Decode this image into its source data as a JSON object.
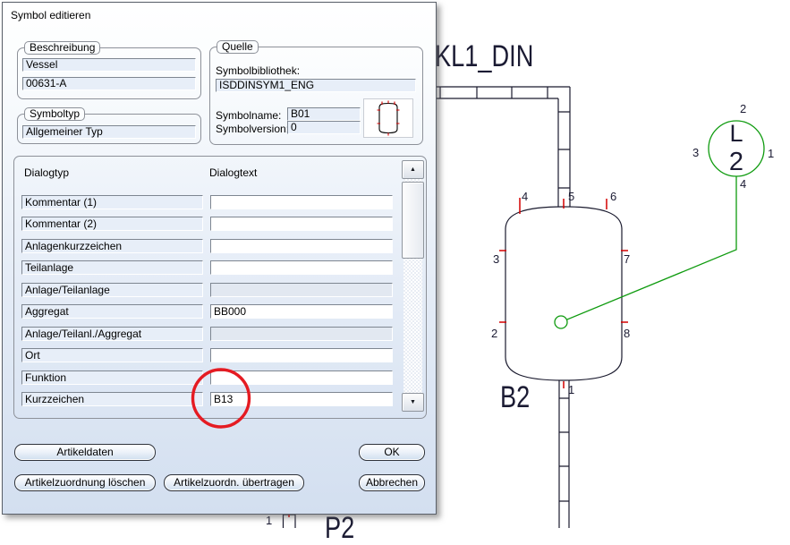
{
  "dialog": {
    "title": "Symbol editieren",
    "beschreibung": {
      "caption": "Beschreibung",
      "line1": "Vessel",
      "line2": "00631-A"
    },
    "symboltyp": {
      "caption": "Symboltyp",
      "value": "Allgemeiner Typ"
    },
    "quelle": {
      "caption": "Quelle",
      "library_label": "Symbolbibliothek:",
      "library_value": "ISDDINSYM1_ENG",
      "name_label": "Symbolname:",
      "name_value": "B01",
      "version_label": "Symbolversion:",
      "version_value": "0"
    },
    "table": {
      "col_headers": [
        "Dialogtyp",
        "Dialogtext"
      ],
      "rows": [
        {
          "label": "Kommentar (1)",
          "value": "",
          "state": "editable"
        },
        {
          "label": "Kommentar (2)",
          "value": "",
          "state": "editable"
        },
        {
          "label": "Anlagenkurzzeichen",
          "value": "",
          "state": "editable"
        },
        {
          "label": "Teilanlage",
          "value": "",
          "state": "editable"
        },
        {
          "label": "Anlage/Teilanlage",
          "value": "",
          "state": "disabled"
        },
        {
          "label": "Aggregat",
          "value": "BB000",
          "state": "editable"
        },
        {
          "label": "Anlage/Teilanl./Aggregat",
          "value": "",
          "state": "disabled"
        },
        {
          "label": "Ort",
          "value": "",
          "state": "editable"
        },
        {
          "label": "Funktion",
          "value": "",
          "state": "editable"
        },
        {
          "label": "Kurzzeichen",
          "value": "B13",
          "state": "editable"
        }
      ]
    },
    "buttons": {
      "artikeldaten": "Artikeldaten",
      "ok": "OK",
      "zuordnung_loeschen": "Artikelzuordnung löschen",
      "zuordn_uebertragen": "Artikelzuordn. übertragen",
      "abbrechen": "Abbrechen"
    },
    "scrollbar": {
      "up_icon": "▲",
      "down_icon": "▼"
    }
  },
  "diagram": {
    "sheet_title": "KL1_DIN",
    "vessel": {
      "tag": "B2",
      "ports": {
        "p1": "1",
        "p2": "2",
        "p3": "3",
        "p4": "4",
        "p5": "5",
        "p6": "6",
        "p7": "7",
        "p8": "8"
      }
    },
    "pump": {
      "tag": "P2",
      "port1": "1"
    },
    "instrument": {
      "line1": "L",
      "line2": "2",
      "ports": {
        "p1": "1",
        "p2": "2",
        "p3": "3",
        "p4": "4"
      }
    },
    "colors": {
      "line": "#1a1a2e",
      "port_tick": "#d40000",
      "instrument_green": "#0f9b0f",
      "annotation_red": "#e51b22",
      "text": "#1b1b33"
    }
  },
  "annotation": {
    "shape": "red-circle-highlight"
  }
}
